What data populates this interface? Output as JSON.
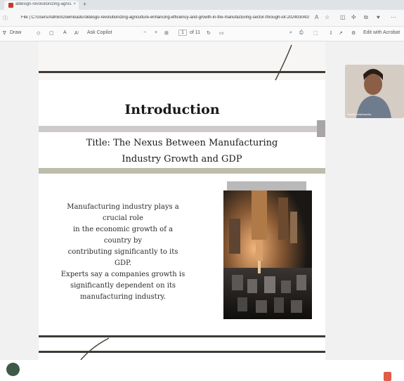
{
  "browser": {
    "tab_title": "aldesign-revolutionizing-agriculture...",
    "tab_close": "×",
    "new_tab": "+",
    "url": "File | C:/Users/Admin/Downloads/slidesgo-revolutionizing-agriculture-enhancing-efficiency-and-growth-in-the-manufacturing-sector-through-iot-2024030410470..."
  },
  "pdf_toolbar": {
    "draw_label": "Draw",
    "ask_copilot_label": "Ask Copilot",
    "zoom_minus": "−",
    "zoom_plus": "+",
    "page_current": "1",
    "page_total": "of 11",
    "edit_acrobat_label": "Edit with Acrobat"
  },
  "slide": {
    "heading": "Introduction",
    "subtitle_line1": "Title: The Nexus Between Manufacturing",
    "subtitle_line2": "Industry Growth and GDP",
    "body_lines": [
      "Manufacturing industry plays a crucial role",
      "in the economic growth of a country by",
      "contributing significantly to its GDP.",
      "Experts say a companies growth is",
      "significantly dependent on its",
      "manufacturing industry."
    ],
    "image": "factory-machinery-photo"
  },
  "video_call": {
    "participant_name": "Swathi Vaishnavika"
  },
  "colors": {
    "band_dark": "#3e3b37",
    "band_gray": "#cfcaca",
    "band_olive": "#bdbcac",
    "accent_red": "#e05c46"
  }
}
